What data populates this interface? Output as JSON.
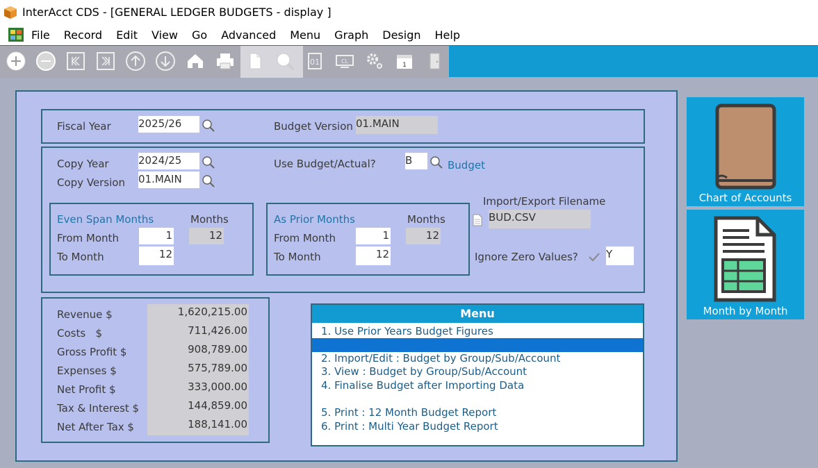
{
  "window": {
    "title": "InterAcct CDS - [GENERAL LEDGER BUDGETS - display ]"
  },
  "menubar": {
    "items": [
      "File",
      "Record",
      "Edit",
      "View",
      "Go",
      "Advanced",
      "Menu",
      "Graph",
      "Design",
      "Help"
    ]
  },
  "toolbar": {
    "icons": [
      "add-record-icon",
      "delete-record-icon",
      "first-record-icon",
      "last-record-icon",
      "previous-record-icon",
      "next-record-icon",
      "home-icon",
      "print-icon",
      "new-document-icon",
      "search-icon",
      "calculator-icon",
      "keyboard-icon",
      "settings-icon",
      "calendar-icon",
      "exit-door-icon"
    ]
  },
  "header": {
    "fiscal_year_label": "Fiscal Year",
    "fiscal_year_value": "2025/26",
    "budget_version_label": "Budget Version",
    "budget_version_value": "01.MAIN"
  },
  "copy": {
    "copy_year_label": "Copy Year",
    "copy_year_value": "2024/25",
    "copy_version_label": "Copy Version",
    "copy_version_value": "01.MAIN",
    "use_budget_label": "Use Budget/Actual?",
    "use_budget_value": "B",
    "use_budget_desc": "Budget",
    "even_span": {
      "title": "Even Span Months",
      "months_label": "Months",
      "months_value": "12",
      "from_label": "From Month",
      "from_value": "1",
      "to_label": "To Month",
      "to_value": "12"
    },
    "prior_months": {
      "title": "As Prior Months",
      "months_label": "Months",
      "months_value": "12",
      "from_label": "From Month",
      "from_value": "1",
      "to_label": "To Month",
      "to_value": "12"
    },
    "import_label": "Import/Export Filename",
    "import_value": "BUD.CSV",
    "ignore_zero_label": "Ignore Zero Values?",
    "ignore_zero_value": "Y"
  },
  "summary": {
    "rows": [
      {
        "label": "Revenue $",
        "value": "1,620,215.00"
      },
      {
        "label": "Costs   $",
        "value": "711,426.00"
      },
      {
        "label": "Gross Profit $",
        "value": "908,789.00"
      },
      {
        "label": "Expenses $",
        "value": "575,789.00"
      },
      {
        "label": "Net Profit $",
        "value": "333,000.00"
      },
      {
        "label": "Tax & Interest $",
        "value": "144,859.00"
      },
      {
        "label": "Net After Tax $",
        "value": "188,141.00"
      }
    ]
  },
  "menu": {
    "title": "Menu",
    "items": [
      "1. Use Prior Years Budget Figures",
      "2. Import/Edit : Budget by Group/Sub/Account",
      "3. View : Budget by Group/Sub/Account",
      "4. Finalise Budget after Importing Data",
      "5. Print :  12 Month Budget Report",
      "6. Print : Multi Year Budget Report"
    ]
  },
  "side_buttons": {
    "chart_of_accounts": "Chart of Accounts",
    "month_by_month": "Month by Month"
  },
  "colors": {
    "toolbar": "#129ad3",
    "panel": "#b8c0ee",
    "border": "#2d6a80",
    "selection": "#0f74d1"
  }
}
